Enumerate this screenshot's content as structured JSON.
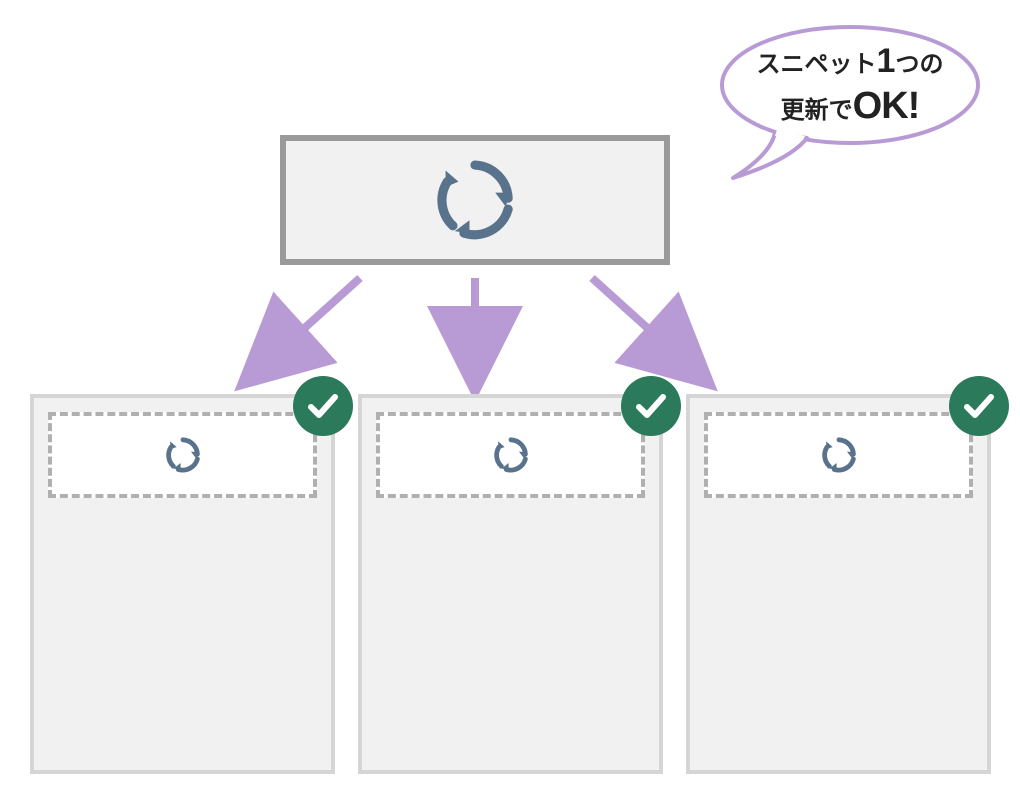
{
  "bubble": {
    "line1_prefix": "スニペット",
    "line1_big": "1",
    "line1_suffix": "つの",
    "line2_prefix": "更新で",
    "line2_ok": "OK!"
  },
  "colors": {
    "bubble_stroke": "#b89bd4",
    "arrow": "#b89bd4",
    "snippet_border": "#9a9a9a",
    "panel_fill": "#f1f1f1",
    "page_border": "#d5d5d5",
    "dashed_border": "#b0b0b0",
    "recycle": "#5a738c",
    "check_bg": "#2b7a5b",
    "check_tick": "#ffffff"
  },
  "icons": {
    "snippet": "recycle",
    "child": "recycle",
    "badge": "check"
  },
  "child_count": 3
}
